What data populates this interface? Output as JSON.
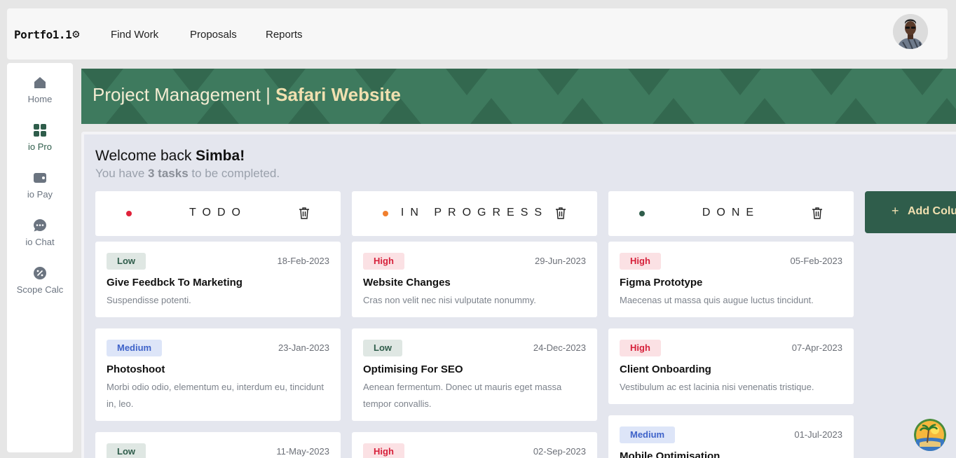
{
  "app": {
    "logo": "Portfo1.1",
    "logo_icon": "gear-icon"
  },
  "nav": {
    "items": [
      {
        "label": "Find Work"
      },
      {
        "label": "Proposals"
      },
      {
        "label": "Reports"
      }
    ]
  },
  "sidebar": {
    "items": [
      {
        "label": "Home",
        "icon": "home-icon",
        "active": false
      },
      {
        "label": "io Pro",
        "icon": "grid-icon",
        "active": true
      },
      {
        "label": "io Pay",
        "icon": "wallet-icon",
        "active": false
      },
      {
        "label": "io Chat",
        "icon": "chat-icon",
        "active": false
      },
      {
        "label": "Scope Calc",
        "icon": "percent-icon",
        "active": false
      }
    ]
  },
  "banner": {
    "prefix": "Project Management | ",
    "project": "Safari Website"
  },
  "welcome": {
    "greeting": "Welcome back ",
    "name": "Simba!",
    "sub_before": "You have ",
    "sub_count": "3 tasks",
    "sub_after": " to be completed."
  },
  "colors": {
    "accent": "#2f5d4b",
    "banner": "#3e7a5e",
    "todo_dot": "#e0223a",
    "progress_dot": "#f07f2e",
    "done_dot": "#2f5d4b"
  },
  "columns": [
    {
      "title": "TODO",
      "cards": [
        {
          "priority": "Low",
          "date": "18-Feb-2023",
          "title": "Give Feedbck To Marketing",
          "desc": "Suspendisse potenti."
        },
        {
          "priority": "Medium",
          "date": "23-Jan-2023",
          "title": "Photoshoot",
          "desc": "Morbi odio odio, elementum eu, interdum eu, tincidunt in, leo."
        },
        {
          "priority": "Low",
          "date": "11-May-2023",
          "title": "",
          "desc": ""
        }
      ]
    },
    {
      "title": "IN PROGRESS",
      "cards": [
        {
          "priority": "High",
          "date": "29-Jun-2023",
          "title": "Website Changes",
          "desc": "Cras non velit nec nisi vulputate nonummy."
        },
        {
          "priority": "Low",
          "date": "24-Dec-2023",
          "title": "Optimising For SEO",
          "desc": "Aenean fermentum. Donec ut mauris eget massa tempor convallis."
        },
        {
          "priority": "High",
          "date": "02-Sep-2023",
          "title": "",
          "desc": ""
        }
      ]
    },
    {
      "title": "DONE",
      "cards": [
        {
          "priority": "High",
          "date": "05-Feb-2023",
          "title": "Figma Prototype",
          "desc": "Maecenas ut massa quis augue luctus tincidunt."
        },
        {
          "priority": "High",
          "date": "07-Apr-2023",
          "title": "Client Onboarding",
          "desc": "Vestibulum ac est lacinia nisi venenatis tristique."
        },
        {
          "priority": "Medium",
          "date": "01-Jul-2023",
          "title": "Mobile Optimisation",
          "desc": ""
        }
      ]
    }
  ],
  "add_column": {
    "label": "Add Colu"
  }
}
